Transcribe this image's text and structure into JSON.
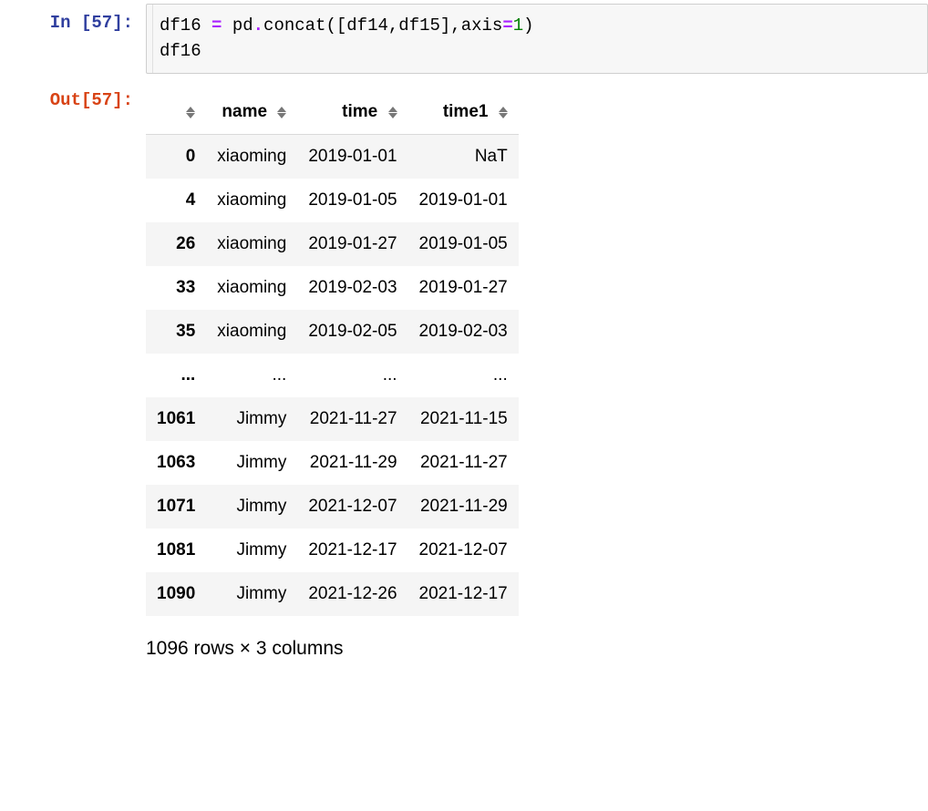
{
  "input": {
    "prompt": "In [57]:",
    "code_parts": {
      "v1": "df16",
      "v2": "pd",
      "v3": "concat",
      "v4": "df14",
      "v5": "df15",
      "v6": "axis",
      "n1": "1",
      "l2": "df16"
    }
  },
  "output": {
    "prompt": "Out[57]:",
    "columns": {
      "idx": "",
      "c1": "name",
      "c2": "time",
      "c3": "time1"
    },
    "rows": [
      {
        "idx": "0",
        "name": "xiaoming",
        "time": "2019-01-01",
        "time1": "NaT"
      },
      {
        "idx": "4",
        "name": "xiaoming",
        "time": "2019-01-05",
        "time1": "2019-01-01"
      },
      {
        "idx": "26",
        "name": "xiaoming",
        "time": "2019-01-27",
        "time1": "2019-01-05"
      },
      {
        "idx": "33",
        "name": "xiaoming",
        "time": "2019-02-03",
        "time1": "2019-01-27"
      },
      {
        "idx": "35",
        "name": "xiaoming",
        "time": "2019-02-05",
        "time1": "2019-02-03"
      },
      {
        "idx": "...",
        "name": "...",
        "time": "...",
        "time1": "..."
      },
      {
        "idx": "1061",
        "name": "Jimmy",
        "time": "2021-11-27",
        "time1": "2021-11-15"
      },
      {
        "idx": "1063",
        "name": "Jimmy",
        "time": "2021-11-29",
        "time1": "2021-11-27"
      },
      {
        "idx": "1071",
        "name": "Jimmy",
        "time": "2021-12-07",
        "time1": "2021-11-29"
      },
      {
        "idx": "1081",
        "name": "Jimmy",
        "time": "2021-12-17",
        "time1": "2021-12-07"
      },
      {
        "idx": "1090",
        "name": "Jimmy",
        "time": "2021-12-26",
        "time1": "2021-12-17"
      }
    ],
    "summary": "1096 rows × 3 columns"
  }
}
